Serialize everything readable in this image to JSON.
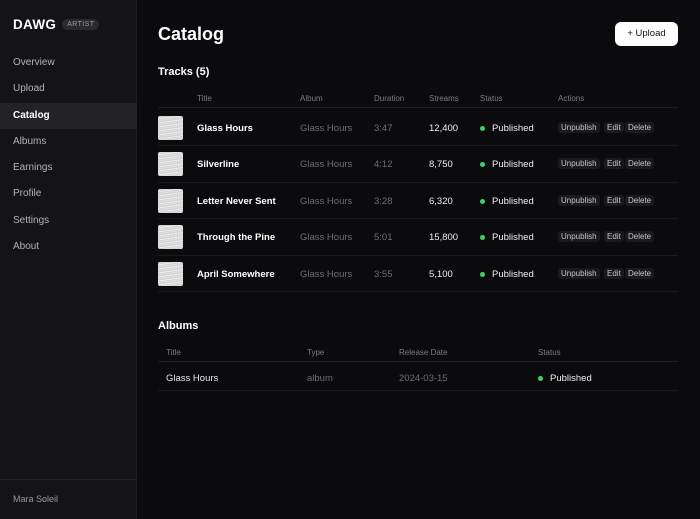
{
  "brand": {
    "name": "DAWG",
    "badge": "ARTIST"
  },
  "nav": [
    {
      "label": "Overview"
    },
    {
      "label": "Upload"
    },
    {
      "label": "Catalog",
      "active": true
    },
    {
      "label": "Albums"
    },
    {
      "label": "Earnings"
    },
    {
      "label": "Profile"
    },
    {
      "label": "Settings"
    },
    {
      "label": "About"
    }
  ],
  "user": {
    "name": "Mara Soleil"
  },
  "page": {
    "title": "Catalog",
    "upload_label": "+ Upload"
  },
  "tracks": {
    "title": "Tracks (5)",
    "columns": {
      "title": "Title",
      "album": "Album",
      "duration": "Duration",
      "streams": "Streams",
      "status": "Status",
      "actions": "Actions"
    },
    "action_labels": {
      "unpublish": "Unpublish",
      "edit": "Edit",
      "delete": "Delete"
    },
    "rows": [
      {
        "title": "Glass Hours",
        "album": "Glass Hours",
        "duration": "3:47",
        "streams": "12,400",
        "status": "Published"
      },
      {
        "title": "Silverline",
        "album": "Glass Hours",
        "duration": "4:12",
        "streams": "8,750",
        "status": "Published"
      },
      {
        "title": "Letter Never Sent",
        "album": "Glass Hours",
        "duration": "3:28",
        "streams": "6,320",
        "status": "Published"
      },
      {
        "title": "Through the Pine",
        "album": "Glass Hours",
        "duration": "5:01",
        "streams": "15,800",
        "status": "Published"
      },
      {
        "title": "April Somewhere",
        "album": "Glass Hours",
        "duration": "3:55",
        "streams": "5,100",
        "status": "Published"
      }
    ]
  },
  "albums": {
    "title": "Albums",
    "columns": {
      "title": "Title",
      "type": "Type",
      "release_date": "Release Date",
      "status": "Status"
    },
    "rows": [
      {
        "title": "Glass Hours",
        "type": "album",
        "release_date": "2024-03-15",
        "status": "Published"
      }
    ]
  },
  "colors": {
    "accent": "#3ecf6b",
    "background": "#0b0a0d",
    "sidebar": "#141316"
  }
}
